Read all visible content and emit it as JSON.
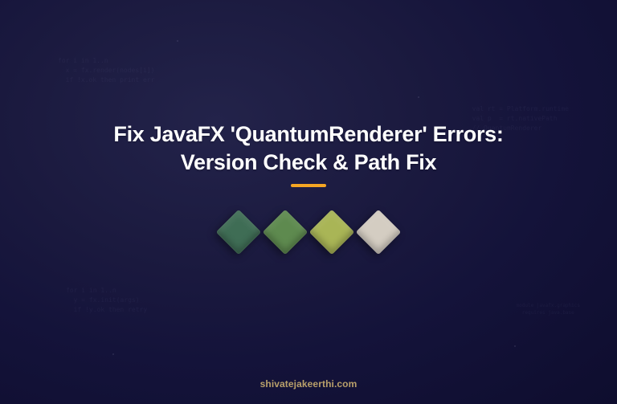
{
  "title_line1": "Fix JavaFX 'QuantumRenderer' Errors:",
  "title_line2": "Version Check & Path Fix",
  "footer_domain": "shivatejakeerthi.com",
  "colors": {
    "accent": "#f5a623",
    "footer_text": "#b9a06a",
    "tile1": "#3f6d55",
    "tile2": "#5e8a4f",
    "tile3": "#a9b556",
    "tile4": "#d4cdc2"
  },
  "bgcode": {
    "c1": "for i in 1..n\n  x = fx.render(nodes[i])\n  if !x.ok then print err",
    "c2": "val rt = Platform.runtime\nval p  = rt.nativePath\n// QuantumRenderer",
    "c3": "for i in 1..n\n  y = fx.init(args)\n  if !y.ok then retry",
    "c4": "module javafx.graphics\n  requires java.base"
  }
}
